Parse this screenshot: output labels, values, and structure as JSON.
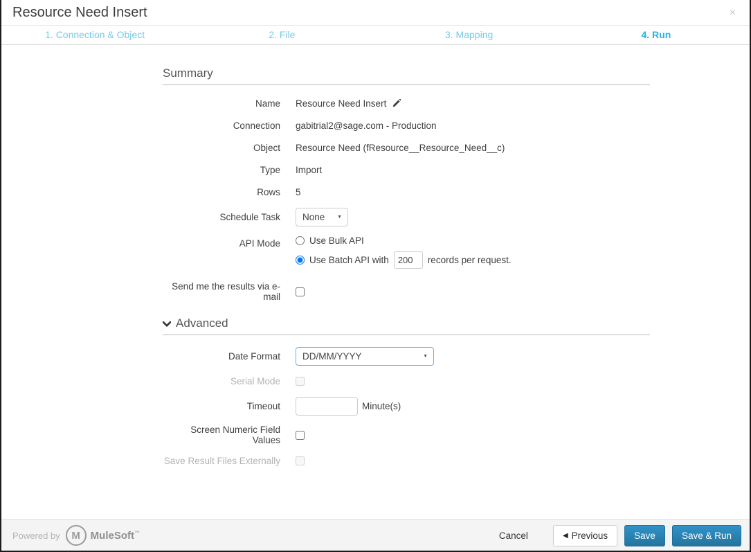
{
  "dialog": {
    "title": "Resource Need Insert",
    "close_icon": "×"
  },
  "steps": [
    {
      "label": "1. Connection & Object",
      "active": false
    },
    {
      "label": "2. File",
      "active": false
    },
    {
      "label": "3. Mapping",
      "active": false
    },
    {
      "label": "4. Run",
      "active": true
    }
  ],
  "summary": {
    "heading": "Summary",
    "name_label": "Name",
    "name_value": "Resource Need Insert",
    "connection_label": "Connection",
    "connection_value": "gabitrial2@sage.com - Production",
    "object_label": "Object",
    "object_value": "Resource Need (fResource__Resource_Need__c)",
    "type_label": "Type",
    "type_value": "Import",
    "rows_label": "Rows",
    "rows_value": "5",
    "schedule_task_label": "Schedule Task",
    "schedule_task_value": "None",
    "api_mode_label": "API Mode",
    "bulk_api_option": "Use Bulk API",
    "batch_api_prefix": "Use Batch API with",
    "batch_size_value": "200",
    "batch_api_suffix": "records per request.",
    "email_label": "Send me the results via e-mail"
  },
  "advanced": {
    "heading": "Advanced",
    "date_format_label": "Date Format",
    "date_format_value": "DD/MM/YYYY",
    "serial_mode_label": "Serial Mode",
    "timeout_label": "Timeout",
    "timeout_suffix": "Minute(s)",
    "screen_numeric_label": "Screen Numeric Field Values",
    "save_result_label": "Save Result Files Externally"
  },
  "footer": {
    "powered_by": "Powered by",
    "brand_initial": "M",
    "brand": "MuleSoft",
    "brand_tm": "™",
    "cancel": "Cancel",
    "previous": "Previous",
    "save": "Save",
    "save_run": "Save & Run"
  },
  "colors": {
    "step_inactive": "#74cbe8",
    "step_active": "#29b1e6",
    "primary_button_top": "#3093c7",
    "primary_button_bottom": "#24749f",
    "focus_select_border": "#66afe9"
  }
}
